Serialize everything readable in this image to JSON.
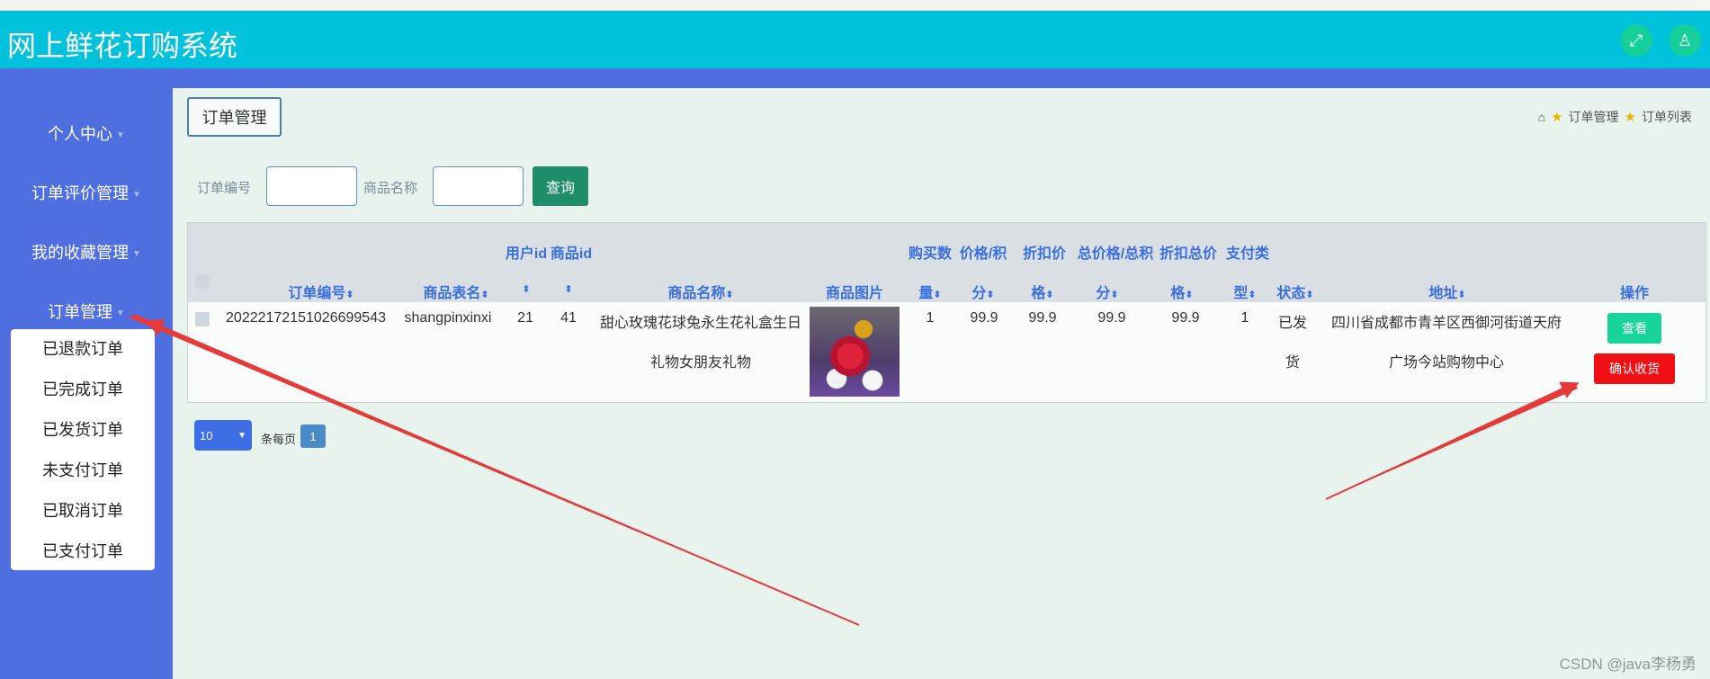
{
  "header": {
    "title": "网上鲜花订购系统",
    "fullscreen_icon": "expand-icon",
    "user_icon": "user-icon"
  },
  "sidebar": {
    "items": [
      {
        "label": "个人中心"
      },
      {
        "label": "订单评价管理"
      },
      {
        "label": "我的收藏管理"
      },
      {
        "label": "订单管理"
      }
    ],
    "submenu": [
      "已退款订单",
      "已完成订单",
      "已发货订单",
      "未支付订单",
      "已取消订单",
      "已支付订单"
    ]
  },
  "tab": {
    "label": "订单管理"
  },
  "breadcrumb": {
    "level1": "订单管理",
    "level2": "订单列表"
  },
  "search": {
    "order_no_label": "订单编号",
    "product_name_label": "商品名称",
    "button": "查询"
  },
  "table": {
    "headers": {
      "order_no": "订单编号",
      "table_name": "商品表名",
      "user_id": "用户id",
      "product_id": "商品id",
      "product_name": "商品名称",
      "image": "商品图片",
      "qty_1": "购买数",
      "qty_2": "量",
      "price_1": "价格/积",
      "price_2": "分",
      "disc_1": "折扣价",
      "disc_2": "格",
      "total_1": "总价格/总积",
      "total_2": "分",
      "disc_total_1": "折扣总价",
      "disc_total_2": "格",
      "pay_1": "支付类",
      "pay_2": "型",
      "status": "状态",
      "address": "地址",
      "action": "操作"
    },
    "row": {
      "order_no": "20222172151026699543",
      "table_name": "shangpinxinxi",
      "user_id": "21",
      "product_id": "41",
      "product_name_1": "甜心玫瑰花球兔永生花礼盒生日",
      "product_name_2": "礼物女朋友礼物",
      "qty": "1",
      "price": "99.9",
      "disc_price": "99.9",
      "total": "99.9",
      "disc_total": "99.9",
      "pay_type": "1",
      "status_1": "已发",
      "status_2": "货",
      "address_1": "四川省成都市青羊区西御河街道天府",
      "address_2": "广场今站购物中心",
      "view_btn": "查看",
      "confirm_btn": "确认收货"
    }
  },
  "pager": {
    "page_size": "10",
    "per_page_label": "条每页",
    "current_page": "1"
  },
  "watermark": "CSDN @java李杨勇"
}
